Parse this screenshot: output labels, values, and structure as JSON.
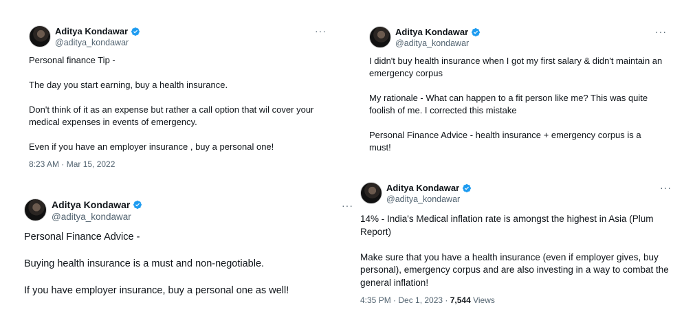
{
  "tweets": [
    {
      "name": "Aditya Kondawar",
      "handle": "@aditya_kondawar",
      "text": "Personal finance Tip -\n\nThe day you start earning, buy a health insurance.\n\nDon't think of it as an expense but rather a call option that wil cover your medical expenses in events of emergency.\n\nEven if you have an employer insurance , buy a personal one!",
      "timestamp": "8:23 AM · Mar 15, 2022",
      "more": "···"
    },
    {
      "name": "Aditya Kondawar",
      "handle": "@aditya_kondawar",
      "text": "I didn't buy health insurance when I got my first salary & didn't maintain an emergency corpus\n\nMy rationale - What can happen to a fit person like me? This was quite foolish of me. I corrected this mistake\n\nPersonal Finance Advice - health insurance + emergency corpus is a must!",
      "more": "···"
    },
    {
      "name": "Aditya Kondawar",
      "handle": "@aditya_kondawar",
      "text": "Personal Finance Advice -\n\nBuying health insurance is a must and non-negotiable.\n\nIf you have employer insurance, buy a personal one as well!",
      "more": "···"
    },
    {
      "name": "Aditya Kondawar",
      "handle": "@aditya_kondawar",
      "text": "14% - India's Medical inflation rate is amongst the highest in Asia (Plum Report)\n\nMake sure that you have a health insurance (even if employer gives, buy personal), emergency corpus and are also investing in a way to combat the general inflation!",
      "timestamp": "4:35 PM · Dec 1, 2023 · ",
      "views_count": "7,544",
      "views_label": " Views",
      "more": "···"
    }
  ],
  "colors": {
    "verified": "#1d9bf0",
    "secondary": "#536471",
    "text": "#0f1419"
  }
}
